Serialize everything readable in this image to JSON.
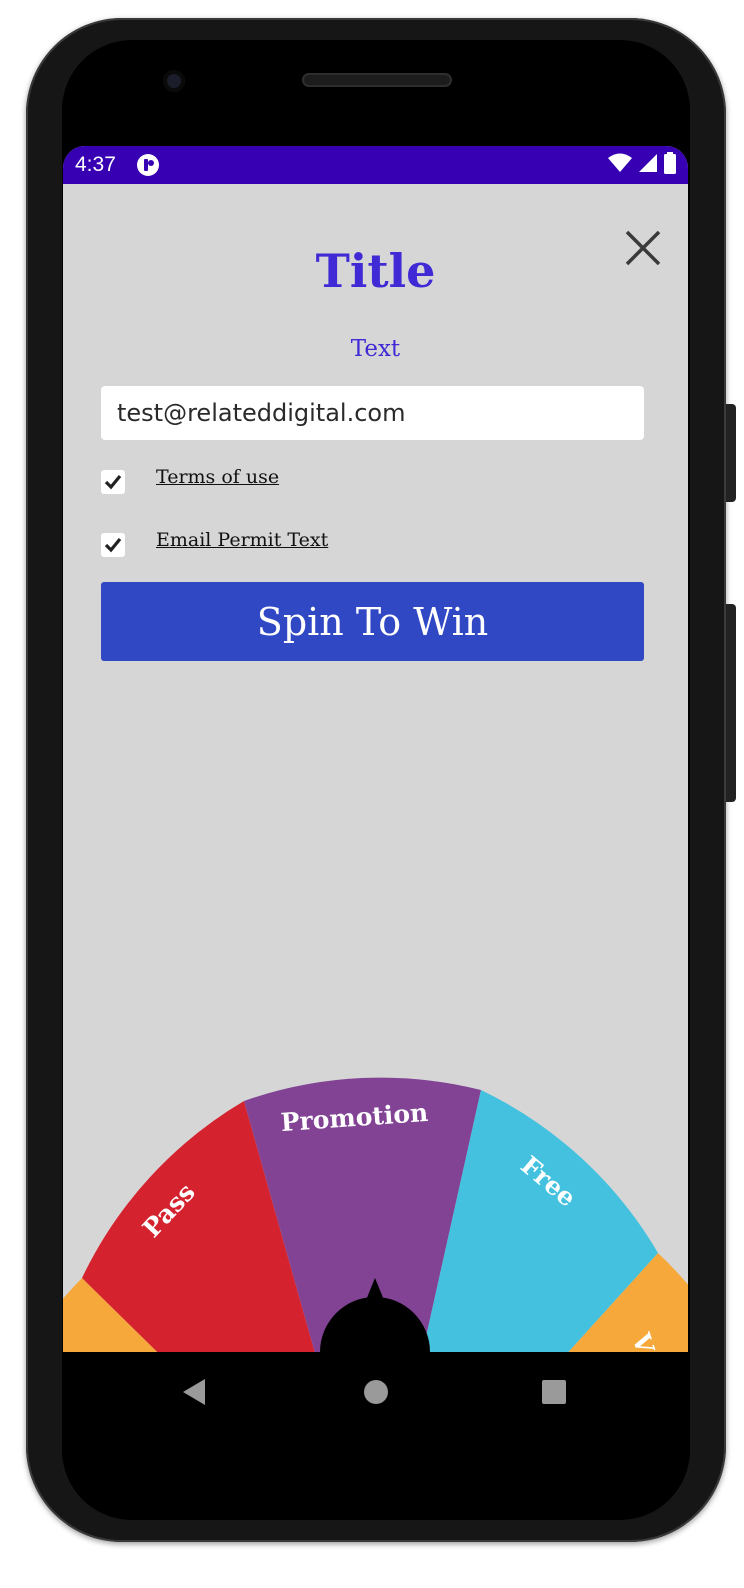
{
  "status_bar": {
    "time": "4:37",
    "app_icon": "notification-app-icon",
    "wifi_icon": "wifi-icon",
    "signal_icon": "cellular-signal-icon",
    "battery_icon": "battery-icon",
    "color": "#3700b3"
  },
  "popup": {
    "title": "Title",
    "text": "Text",
    "email_value": "test@relateddigital.com",
    "close_icon": "close-icon",
    "terms_label": "Terms of use",
    "terms_checked": true,
    "email_permit_label": "Email Permit Text",
    "email_permit_checked": true,
    "spin_button_label": "Spin To Win",
    "background_color": "#d6d6d6",
    "title_color": "#3f2ad6",
    "button_color": "#3048c4"
  },
  "wheel": {
    "slices": [
      {
        "label": "",
        "color": "#f6a83b"
      },
      {
        "label": "Pass",
        "color": "#d4232f"
      },
      {
        "label": "Promotion",
        "color": "#824395"
      },
      {
        "label": "Free",
        "color": "#44c1df"
      },
      {
        "label": "V",
        "color": "#f6a83b"
      }
    ],
    "pointer_icon": "wheel-pointer-icon"
  },
  "nav_bar": {
    "back_icon": "back-triangle-icon",
    "home_icon": "home-circle-icon",
    "recents_icon": "recents-square-icon"
  }
}
